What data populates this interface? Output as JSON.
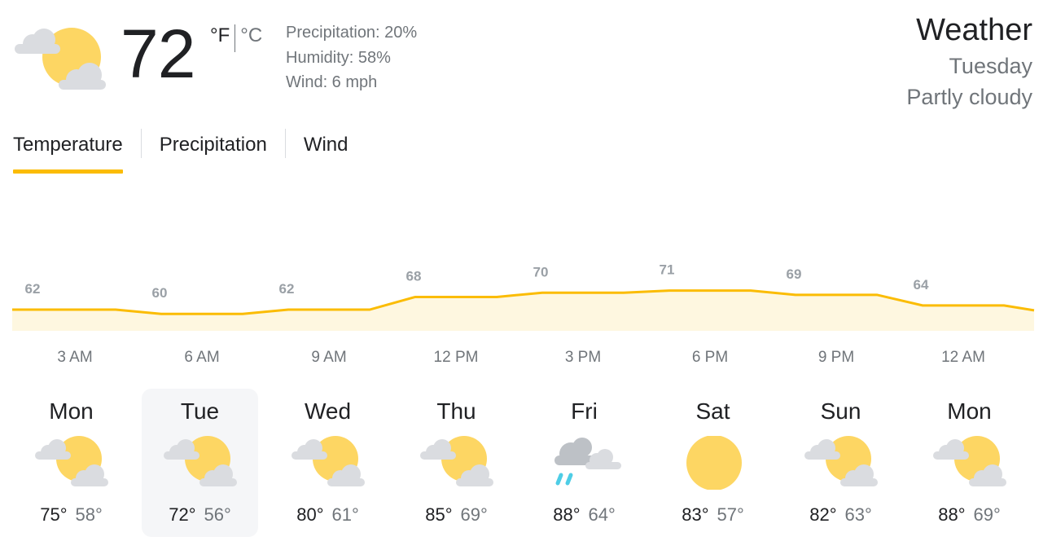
{
  "current": {
    "temperature": "72",
    "unit_f": "°F",
    "unit_c": "°C",
    "precipitation": "Precipitation: 20%",
    "humidity": "Humidity: 58%",
    "wind": "Wind: 6 mph",
    "icon": "partly-cloudy-icon"
  },
  "header": {
    "title": "Weather",
    "day": "Tuesday",
    "condition": "Partly cloudy"
  },
  "tabs": [
    {
      "label": "Temperature",
      "active": true
    },
    {
      "label": "Precipitation",
      "active": false
    },
    {
      "label": "Wind",
      "active": false
    }
  ],
  "chart_data": {
    "type": "area",
    "x": [
      "3 AM",
      "6 AM",
      "9 AM",
      "12 PM",
      "3 PM",
      "6 PM",
      "9 PM",
      "12 AM"
    ],
    "values": [
      62,
      60,
      62,
      68,
      70,
      71,
      69,
      64
    ],
    "series": [
      {
        "values": [
          62,
          60,
          62,
          68,
          70,
          71,
          69,
          64
        ]
      }
    ],
    "ylim": [
      52,
      72
    ],
    "color": "#fbbc04",
    "fill": "#fef7e0"
  },
  "hours": [
    "3 AM",
    "6 AM",
    "9 AM",
    "12 PM",
    "3 PM",
    "6 PM",
    "9 PM",
    "12 AM"
  ],
  "forecast": [
    {
      "day": "Mon",
      "high": "75°",
      "low": "58°",
      "icon": "partly-cloudy-icon",
      "selected": false
    },
    {
      "day": "Tue",
      "high": "72°",
      "low": "56°",
      "icon": "partly-cloudy-icon",
      "selected": true
    },
    {
      "day": "Wed",
      "high": "80°",
      "low": "61°",
      "icon": "partly-cloudy-icon",
      "selected": false
    },
    {
      "day": "Thu",
      "high": "85°",
      "low": "69°",
      "icon": "partly-cloudy-icon",
      "selected": false
    },
    {
      "day": "Fri",
      "high": "88°",
      "low": "64°",
      "icon": "rain-icon",
      "selected": false
    },
    {
      "day": "Sat",
      "high": "83°",
      "low": "57°",
      "icon": "sun-icon",
      "selected": false
    },
    {
      "day": "Sun",
      "high": "82°",
      "low": "63°",
      "icon": "partly-cloudy-icon",
      "selected": false
    },
    {
      "day": "Mon",
      "high": "88°",
      "low": "69°",
      "icon": "partly-cloudy-icon",
      "selected": false
    }
  ],
  "colors": {
    "accent": "#fbbc04",
    "sun": "#fdd663",
    "cloud": "#dadce0",
    "rain": "#4ecde6",
    "muted_text": "#70757a"
  }
}
